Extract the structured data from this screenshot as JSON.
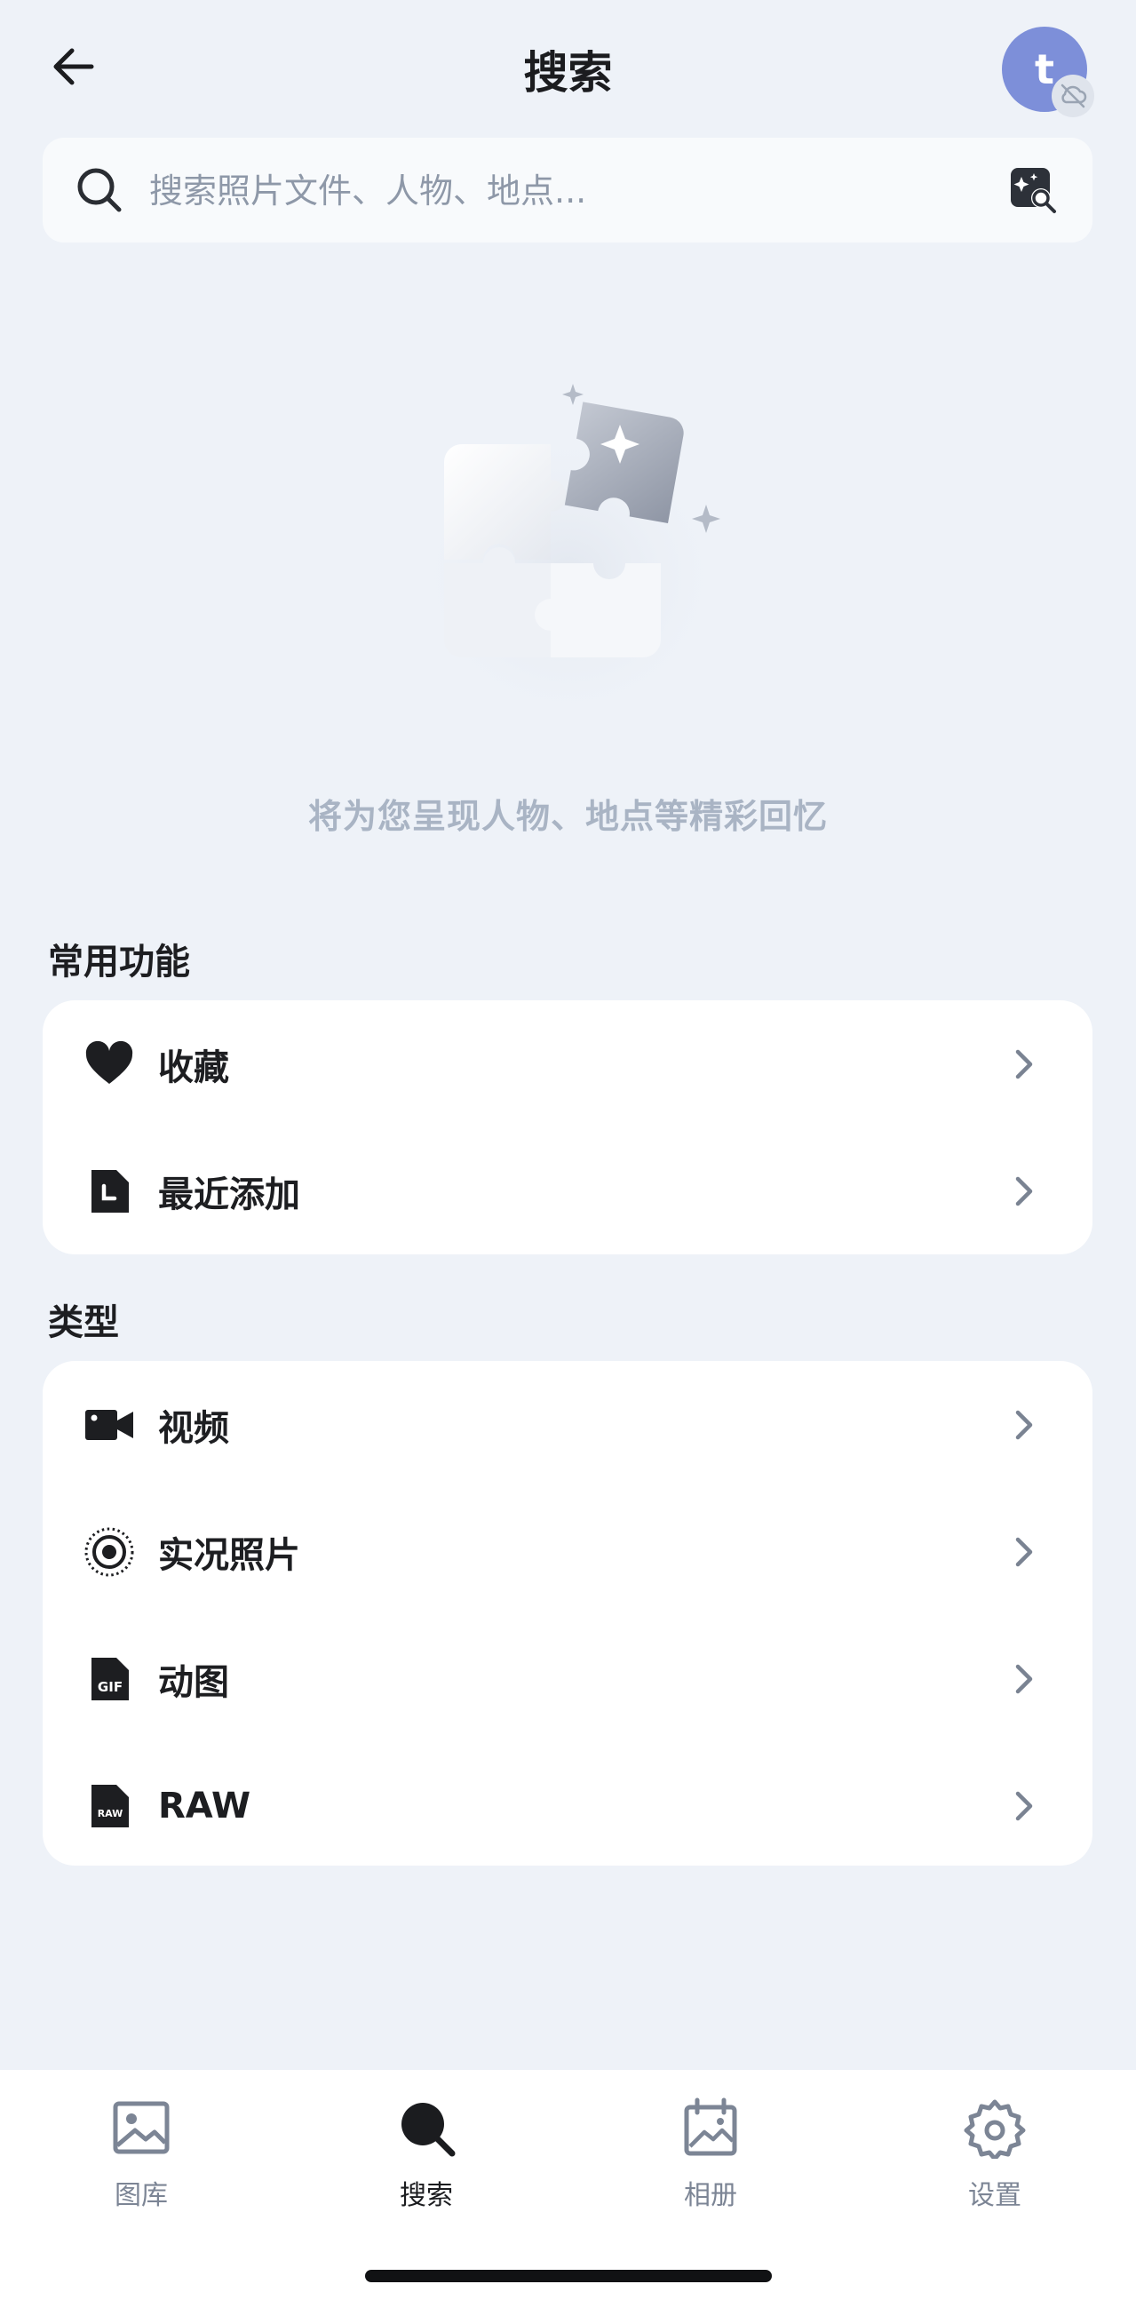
{
  "header": {
    "title": "搜索",
    "avatar_letter": "t"
  },
  "search": {
    "placeholder": "搜索照片文件、人物、地点..."
  },
  "empty_state": {
    "hint": "将为您呈现人物、地点等精彩回忆"
  },
  "sections": {
    "common": {
      "title": "常用功能",
      "items": [
        {
          "label": "收藏",
          "icon": "heart-icon"
        },
        {
          "label": "最近添加",
          "icon": "recent-added-icon"
        }
      ]
    },
    "types": {
      "title": "类型",
      "items": [
        {
          "label": "视频",
          "icon": "video-camera-icon"
        },
        {
          "label": "实况照片",
          "icon": "live-photo-icon"
        },
        {
          "label": "动图",
          "icon": "gif-file-icon"
        },
        {
          "label": "RAW",
          "icon": "raw-file-icon"
        }
      ]
    }
  },
  "bottom_nav": {
    "items": [
      {
        "label": "图库",
        "icon": "gallery-icon",
        "active": false
      },
      {
        "label": "搜索",
        "icon": "search-icon",
        "active": true
      },
      {
        "label": "相册",
        "icon": "album-icon",
        "active": false
      },
      {
        "label": "设置",
        "icon": "settings-gear-icon",
        "active": false
      }
    ]
  },
  "colors": {
    "background": "#eef2f8",
    "card": "#ffffff",
    "avatar": "#7d8fd9",
    "hint_text": "#a9b4c4",
    "nav_inactive": "#7c8595"
  }
}
